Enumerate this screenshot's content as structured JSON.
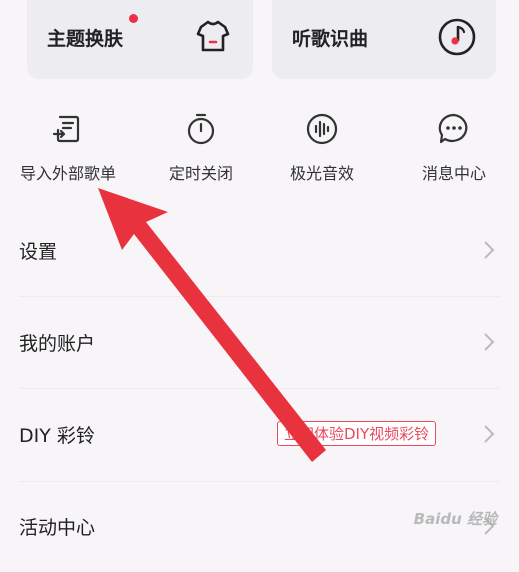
{
  "top_cards": {
    "theme_label": "主题换肤",
    "music_id_label": "听歌识曲"
  },
  "quick_actions": [
    {
      "label": "导入外部歌单",
      "icon": "import-playlist-icon"
    },
    {
      "label": "定时关闭",
      "icon": "timer-icon"
    },
    {
      "label": "极光音效",
      "icon": "sound-effect-icon"
    },
    {
      "label": "消息中心",
      "icon": "message-icon"
    }
  ],
  "menu": [
    {
      "label": "设置"
    },
    {
      "label": "我的账户"
    },
    {
      "label": "DIY 彩铃",
      "promo": "立即体验DIY视频彩铃"
    },
    {
      "label": "活动中心"
    }
  ],
  "watermark": "Baidu 经验",
  "colors": {
    "accent": "#ee2f47",
    "annotation_arrow": "#e8333f"
  }
}
